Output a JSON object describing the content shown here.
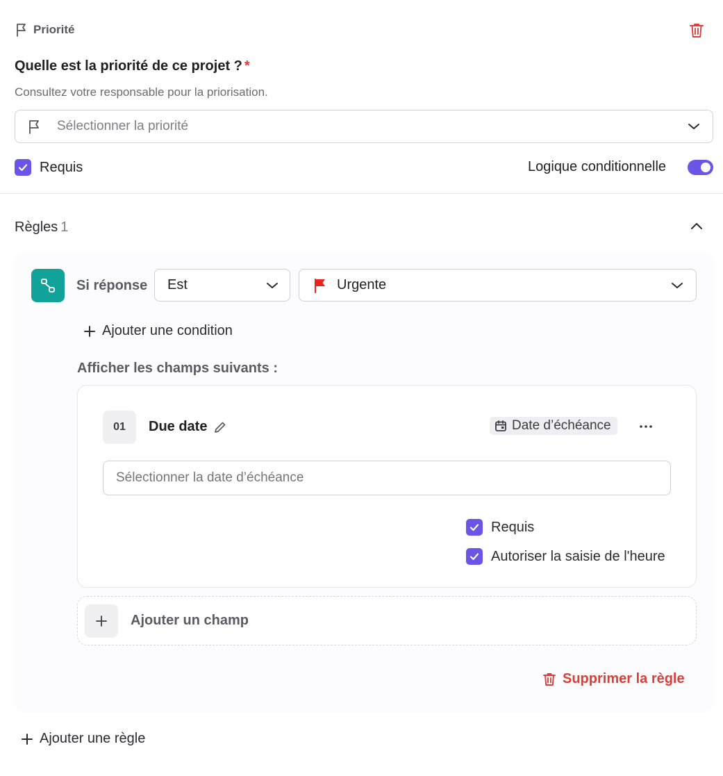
{
  "header": {
    "label": "Priorité",
    "icon": "flag-icon"
  },
  "question": {
    "text": "Quelle est la priorité de ce projet ?",
    "required_mark": "*",
    "help": "Consultez votre responsable pour la priorisation."
  },
  "priority_select": {
    "placeholder": "Sélectionner la priorité"
  },
  "required": {
    "label": "Requis",
    "checked": true
  },
  "conditional_logic": {
    "label": "Logique conditionnelle",
    "enabled": true
  },
  "rules": {
    "title": "Règles",
    "count": "1",
    "items": [
      {
        "condition_label": "Si réponse",
        "operator": "Est",
        "value": "Urgente",
        "value_flag_color": "#e8231c",
        "add_condition": "Ajouter une condition",
        "show_fields_label": "Afficher les champs suivants :",
        "fields": [
          {
            "number": "01",
            "name": "Due date",
            "type": "Date d’échéance",
            "placeholder": "Sélectionner la date d’échéance",
            "options": [
              {
                "label": "Requis",
                "checked": true
              },
              {
                "label": "Autoriser la saisie de l'heure",
                "checked": true
              }
            ]
          }
        ],
        "add_field": "Ajouter un champ",
        "delete_rule": "Supprimer la règle"
      }
    ],
    "add_rule": "Ajouter une règle"
  },
  "colors": {
    "accent": "#6a55e6",
    "rule_icon_bg": "#11a39a",
    "danger": "#d9403a"
  }
}
